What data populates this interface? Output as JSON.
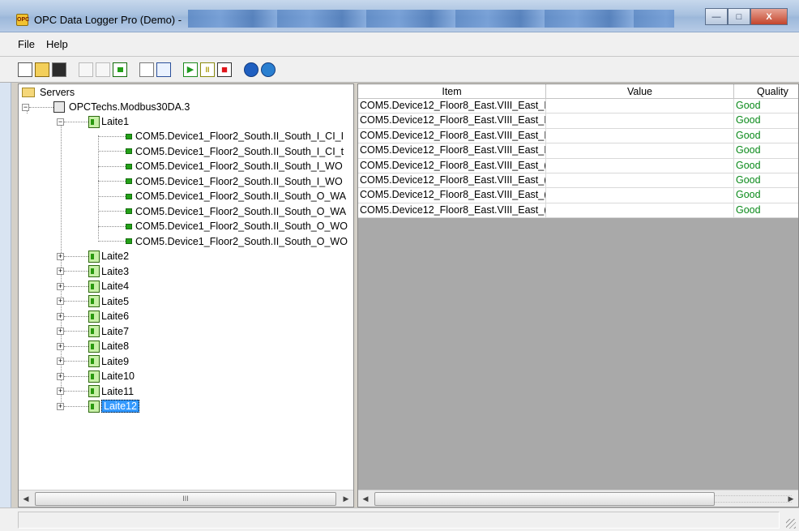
{
  "window": {
    "title": "OPC Data Logger Pro (Demo) -",
    "icon_label": "OPC",
    "minimize_glyph": "—",
    "maximize_glyph": "□",
    "close_glyph": "X"
  },
  "menu": {
    "file": "File",
    "help": "Help"
  },
  "toolbar": {
    "icons": [
      "new-file-icon",
      "open-folder-icon",
      "save-icon",
      "add-server-icon",
      "add-group-icon",
      "add-item-icon",
      "properties-icon",
      "trend-icon",
      "start-icon",
      "pause-icon",
      "stop-icon",
      "globe-icon",
      "globe-arrow-icon"
    ],
    "play": "▶",
    "pause": "II",
    "stop": "■"
  },
  "tree": {
    "root": "Servers",
    "server": "OPCTechs.Modbus30DA.3",
    "device1": "Laite1",
    "tags": [
      "COM5.Device1_Floor2_South.II_South_I_CI_I",
      "COM5.Device1_Floor2_South.II_South_I_CI_t",
      "COM5.Device1_Floor2_South.II_South_I_WO",
      "COM5.Device1_Floor2_South.II_South_I_WO",
      "COM5.Device1_Floor2_South.II_South_O_WA",
      "COM5.Device1_Floor2_South.II_South_O_WA",
      "COM5.Device1_Floor2_South.II_South_O_WO",
      "COM5.Device1_Floor2_South.II_South_O_WO"
    ],
    "devices": [
      "Laite2",
      "Laite3",
      "Laite4",
      "Laite5",
      "Laite6",
      "Laite7",
      "Laite8",
      "Laite9",
      "Laite10",
      "Laite11",
      "Laite12"
    ],
    "selected": "Laite12",
    "scroll_left": "◀",
    "scroll_right": "▶",
    "thumb_grip": "III"
  },
  "list": {
    "columns": [
      "Item",
      "Value",
      "Quality"
    ],
    "rows": [
      {
        "item": "COM5.Device12_Floor8_East.VIII_East_I",
        "value": "",
        "quality": "Good"
      },
      {
        "item": "COM5.Device12_Floor8_East.VIII_East_I",
        "value": "",
        "quality": "Good"
      },
      {
        "item": "COM5.Device12_Floor8_East.VIII_East_I",
        "value": "",
        "quality": "Good"
      },
      {
        "item": "COM5.Device12_Floor8_East.VIII_East_I",
        "value": "",
        "quality": "Good"
      },
      {
        "item": "COM5.Device12_Floor8_East.VIII_East_(",
        "value": "",
        "quality": "Good"
      },
      {
        "item": "COM5.Device12_Floor8_East.VIII_East_(",
        "value": "",
        "quality": "Good"
      },
      {
        "item": "COM5.Device12_Floor8_East.VIII_East_(",
        "value": "",
        "quality": "Good"
      },
      {
        "item": "COM5.Device12_Floor8_East.VIII_East_(",
        "value": "",
        "quality": "Good"
      }
    ],
    "scroll_left": "◀",
    "scroll_right": "▶"
  },
  "colors": {
    "good": "#0b8a1b",
    "selection": "#3399ff",
    "list_bg": "#a9a9a9"
  }
}
